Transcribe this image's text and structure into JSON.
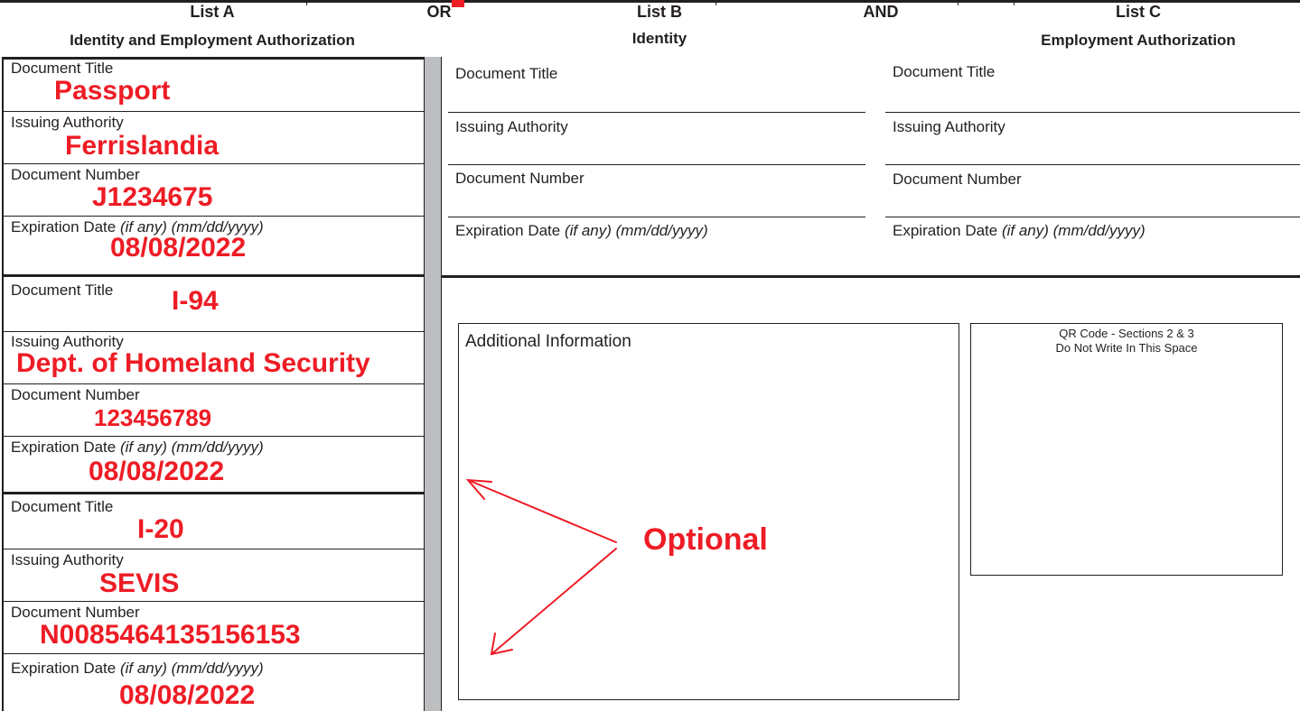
{
  "headers": {
    "list_a": {
      "title": "List A",
      "subtitle": "Identity and Employment Authorization"
    },
    "or": "OR",
    "list_b": {
      "title": "List B",
      "subtitle": "Identity"
    },
    "and": "AND",
    "list_c": {
      "title": "List C",
      "subtitle": "Employment Authorization"
    }
  },
  "labels": {
    "doc_title": "Document Title",
    "issuing": "Issuing Authority",
    "doc_number": "Document Number",
    "exp_prefix": "Expiration Date ",
    "exp_suffix": "(if any) (mm/dd/yyyy)"
  },
  "list_a_docs": [
    {
      "title": "Passport",
      "issuer": "Ferrislandia",
      "number": "J1234675",
      "expiration": "08/08/2022"
    },
    {
      "title": "I-94",
      "issuer": "Dept. of Homeland Security",
      "number": "123456789",
      "expiration": "08/08/2022"
    },
    {
      "title": "I-20",
      "issuer": "SEVIS",
      "number": "N0085464135156153",
      "expiration": "08/08/2022"
    }
  ],
  "additional_info": {
    "label": "Additional Information",
    "annotation": "Optional"
  },
  "qr": {
    "line1": "QR Code - Sections 2 & 3",
    "line2": "Do Not Write In This Space"
  },
  "colors": {
    "annotation": "#ee1c25",
    "shade": "#bcbec0",
    "ink": "#231f20"
  }
}
